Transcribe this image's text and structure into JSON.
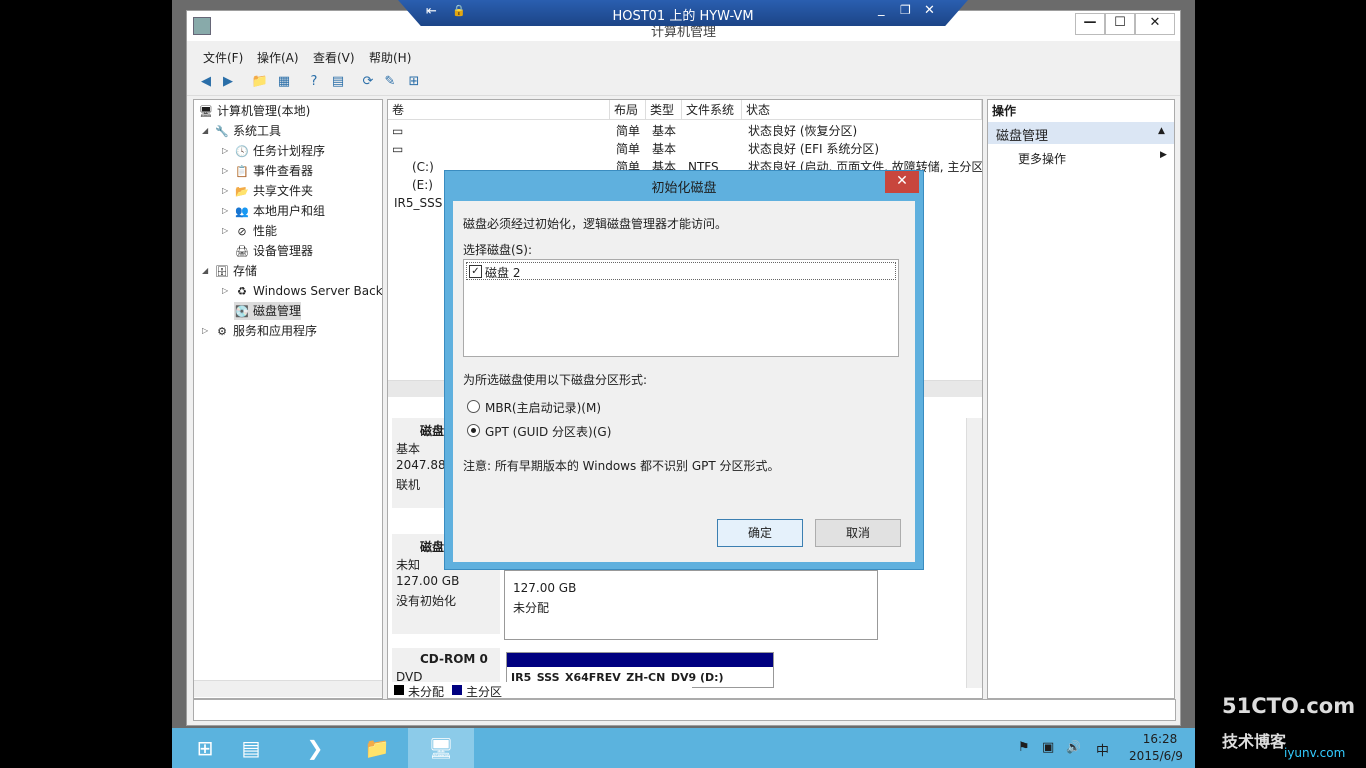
{
  "host_window": {
    "title": "HOST01 上的 HYW-VM",
    "pin_glyph": "⇤",
    "lock_glyph": "🔒",
    "min_glyph": "_",
    "restore_glyph": "❐",
    "close_glyph": "✕"
  },
  "window": {
    "title": "计算机管理",
    "min_glyph": "—",
    "max_glyph": "☐",
    "close_glyph": "✕",
    "menu": [
      "文件(F)",
      "操作(A)",
      "查看(V)",
      "帮助(H)"
    ]
  },
  "toolbar_icons": [
    "back-icon",
    "forward-icon",
    "up-folder-icon",
    "show-hide-tree-icon",
    "help-icon",
    "properties-icon",
    "refresh-icon",
    "export-icon",
    "rescan-icon"
  ],
  "toolbar_glyphs": [
    "◀",
    "▶",
    "📁",
    "▦",
    "?",
    "▤",
    "⟳",
    "✎",
    "⊞"
  ],
  "tree": {
    "root": "计算机管理(本地)",
    "system_tools": "系统工具",
    "task_scheduler": "任务计划程序",
    "event_viewer": "事件查看器",
    "shared_folders": "共享文件夹",
    "local_users": "本地用户和组",
    "performance": "性能",
    "device_manager": "设备管理器",
    "storage": "存储",
    "windows_backup": "Windows Server Back",
    "disk_management": "磁盘管理",
    "services_apps": "服务和应用程序"
  },
  "volume_list": {
    "headers": [
      "卷",
      "布局",
      "类型",
      "文件系统",
      "状态"
    ],
    "rows": [
      {
        "volume": "",
        "layout": "简单",
        "type": "基本",
        "fs": "",
        "status": "状态良好 (恢复分区)"
      },
      {
        "volume": "",
        "layout": "简单",
        "type": "基本",
        "fs": "",
        "status": "状态良好 (EFI 系统分区)"
      },
      {
        "volume": "(C:)",
        "layout": "简单",
        "type": "基本",
        "fs": "NTFS",
        "status": "状态良好 (启动, 页面文件, 故障转储, 主分区"
      },
      {
        "volume": "(E:)",
        "layout": "",
        "type": "",
        "fs": "",
        "status": ""
      },
      {
        "volume": "IR5_SSS",
        "layout": "",
        "type": "",
        "fs": "",
        "status": ""
      }
    ]
  },
  "disks": {
    "disk0": {
      "name": "磁盘",
      "type": "基本",
      "size": "2047.88",
      "state": "联机"
    },
    "disk2": {
      "name": "磁盘",
      "type": "未知",
      "size": "127.00 GB",
      "state": "没有初始化",
      "part_size": "127.00 GB",
      "part_state": "未分配"
    },
    "cdrom": {
      "name": "CD-ROM 0",
      "type": "DVD",
      "label": "IR5_SSS_X64FREV_ZH-CN_DV9 (D:)"
    }
  },
  "legend": {
    "unallocated": "未分配",
    "primary": "主分区",
    "unallocated_color": "#000000",
    "primary_color": "#000080"
  },
  "actions_panel": {
    "header": "操作",
    "section": "磁盘管理",
    "more": "更多操作"
  },
  "dialog": {
    "title": "初始化磁盘",
    "close_glyph": "✕",
    "intro": "磁盘必须经过初始化，逻辑磁盘管理器才能访问。",
    "select_label": "选择磁盘(S):",
    "disks": [
      {
        "label": "磁盘 2",
        "checked": true
      }
    ],
    "style_label": "为所选磁盘使用以下磁盘分区形式:",
    "mbr": "MBR(主启动记录)(M)",
    "gpt": "GPT (GUID 分区表)(G)",
    "selected_style": "GPT",
    "note": "注意: 所有早期版本的 Windows 都不识别 GPT 分区形式。",
    "ok": "确定",
    "cancel": "取消"
  },
  "taskbar": {
    "apps": [
      "start-icon",
      "server-manager-icon",
      "powershell-icon",
      "file-explorer-icon",
      "computer-management-icon"
    ],
    "app_glyphs": [
      "⊞",
      "▤",
      "❯",
      "📁",
      "🖥"
    ],
    "tray_glyphs": [
      "⚑",
      "▣",
      "🔊"
    ],
    "ime": "中",
    "time": "16:28",
    "date": "2015/6/9"
  },
  "watermark": {
    "line1": "51CTO.com",
    "line2": "技术博客",
    "line3": "iyunv.com"
  }
}
